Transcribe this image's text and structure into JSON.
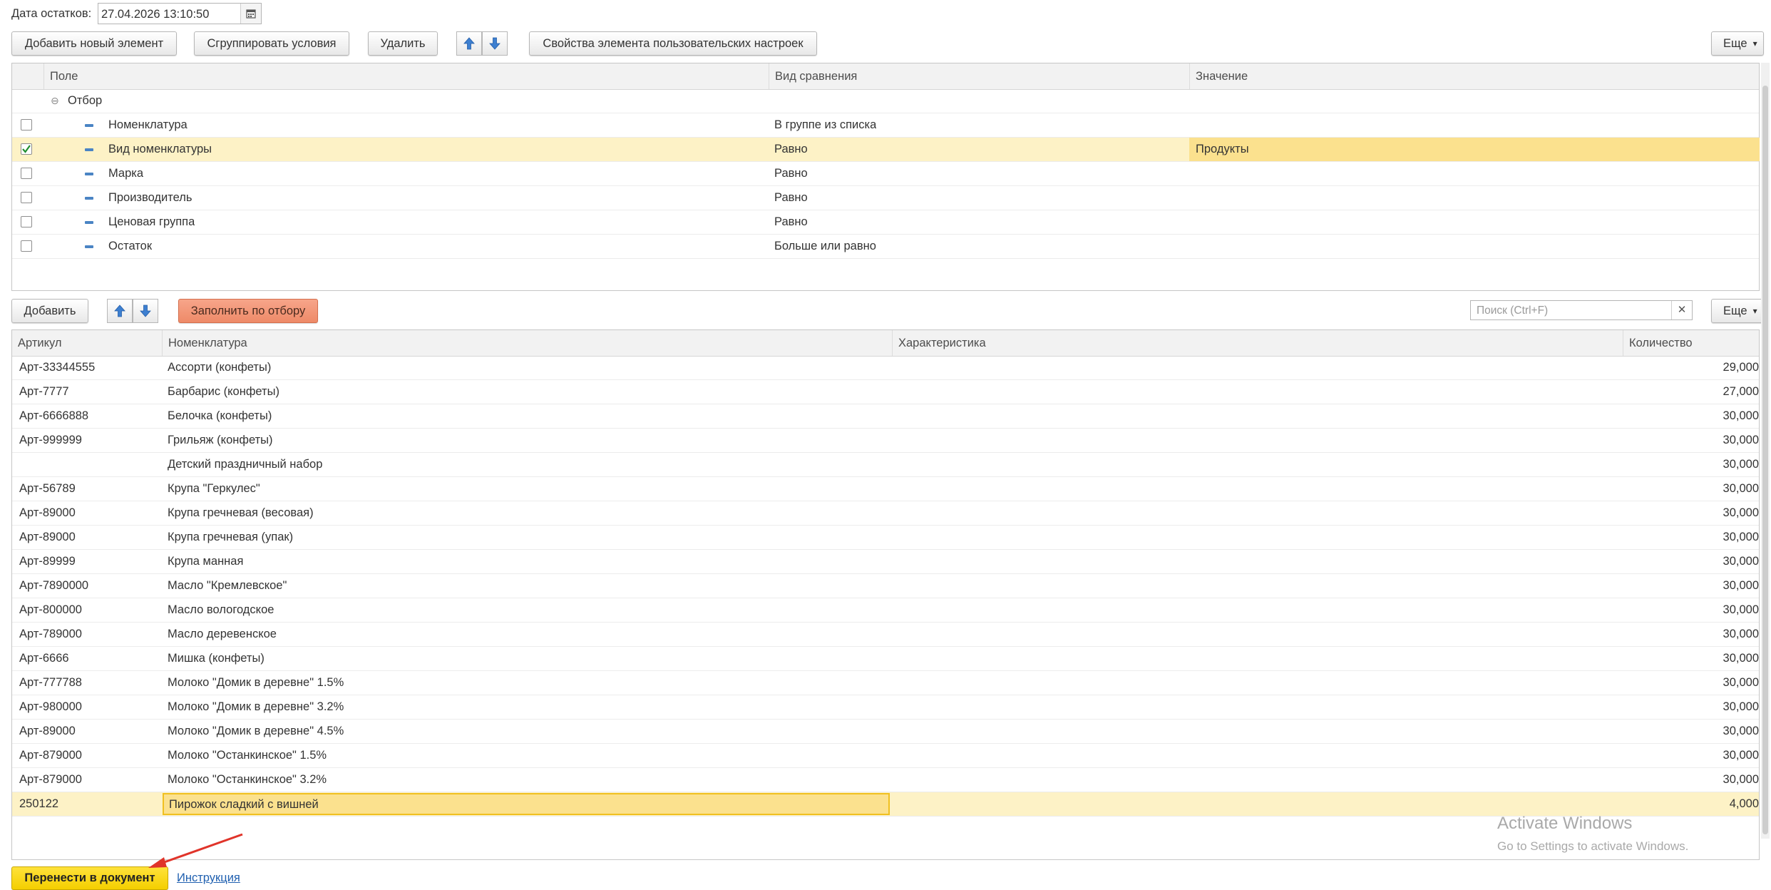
{
  "date_label": "Дата остатков:",
  "date_value": "27.04.2026 13:10:50",
  "toolbar1": {
    "add_new": "Добавить новый элемент",
    "group": "Сгруппировать условия",
    "delete": "Удалить",
    "props": "Свойства элемента пользовательских настроек",
    "more": "Еще"
  },
  "filter_grid": {
    "columns": [
      "Поле",
      "Вид сравнения",
      "Значение"
    ],
    "group_label": "Отбор",
    "rows": [
      {
        "field": "Номенклатура",
        "comparison": "В группе из списка",
        "value": "",
        "checked": false
      },
      {
        "field": "Вид номенклатуры",
        "comparison": "Равно",
        "value": "Продукты",
        "checked": true
      },
      {
        "field": "Марка",
        "comparison": "Равно",
        "value": "",
        "checked": false
      },
      {
        "field": "Производитель",
        "comparison": "Равно",
        "value": "",
        "checked": false
      },
      {
        "field": "Ценовая группа",
        "comparison": "Равно",
        "value": "",
        "checked": false
      },
      {
        "field": "Остаток",
        "comparison": "Больше или равно",
        "value": "",
        "checked": false
      }
    ]
  },
  "toolbar2": {
    "add": "Добавить",
    "fill": "Заполнить по отбору",
    "search_placeholder": "Поиск (Ctrl+F)",
    "more": "Еще"
  },
  "items_grid": {
    "columns": [
      "Артикул",
      "Номенклатура",
      "Характеристика",
      "Количество"
    ],
    "rows": [
      [
        "Арт-33344555",
        "Ассорти (конфеты)",
        "",
        "29,000"
      ],
      [
        "Арт-7777",
        "Барбарис (конфеты)",
        "",
        "27,000"
      ],
      [
        "Арт-6666888",
        "Белочка (конфеты)",
        "",
        "30,000"
      ],
      [
        "Арт-999999",
        "Грильяж (конфеты)",
        "",
        "30,000"
      ],
      [
        "",
        "Детский праздничный набор",
        "",
        "30,000"
      ],
      [
        "Арт-56789",
        "Крупа \"Геркулес\"",
        "",
        "30,000"
      ],
      [
        "Арт-89000",
        "Крупа гречневая (весовая)",
        "",
        "30,000"
      ],
      [
        "Арт-89000",
        "Крупа гречневая (упак)",
        "",
        "30,000"
      ],
      [
        "Арт-89999",
        "Крупа манная",
        "",
        "30,000"
      ],
      [
        "Арт-7890000",
        "Масло \"Кремлевское\"",
        "",
        "30,000"
      ],
      [
        "Арт-800000",
        "Масло вологодское",
        "",
        "30,000"
      ],
      [
        "Арт-789000",
        "Масло деревенское",
        "",
        "30,000"
      ],
      [
        "Арт-6666",
        "Мишка (конфеты)",
        "",
        "30,000"
      ],
      [
        "Арт-777788",
        "Молоко \"Домик в деревне\" 1.5%",
        "",
        "30,000"
      ],
      [
        "Арт-980000",
        "Молоко \"Домик в деревне\" 3.2%",
        "",
        "30,000"
      ],
      [
        "Арт-89000",
        "Молоко \"Домик в деревне\" 4.5%",
        "",
        "30,000"
      ],
      [
        "Арт-879000",
        "Молоко \"Останкинское\" 1.5%",
        "",
        "30,000"
      ],
      [
        "Арт-879000",
        "Молоко \"Останкинское\" 3.2%",
        "",
        "30,000"
      ],
      [
        "250122",
        "Пирожок сладкий с вишней",
        "",
        "4,000"
      ]
    ],
    "selected_row": 18
  },
  "footer": {
    "transfer": "Перенести в документ",
    "instructions": "Инструкция"
  },
  "watermark": {
    "line1": "Activate Windows",
    "line2": "Go to Settings to activate Windows."
  },
  "colors": {
    "accent_yellow": "#f4cf00",
    "fill_orange": "#ee8a68",
    "row_selected": "#fdf2c6",
    "value_selected": "#fbe18e",
    "link_blue": "#2060b0",
    "arrow_red": "#e0342a"
  }
}
